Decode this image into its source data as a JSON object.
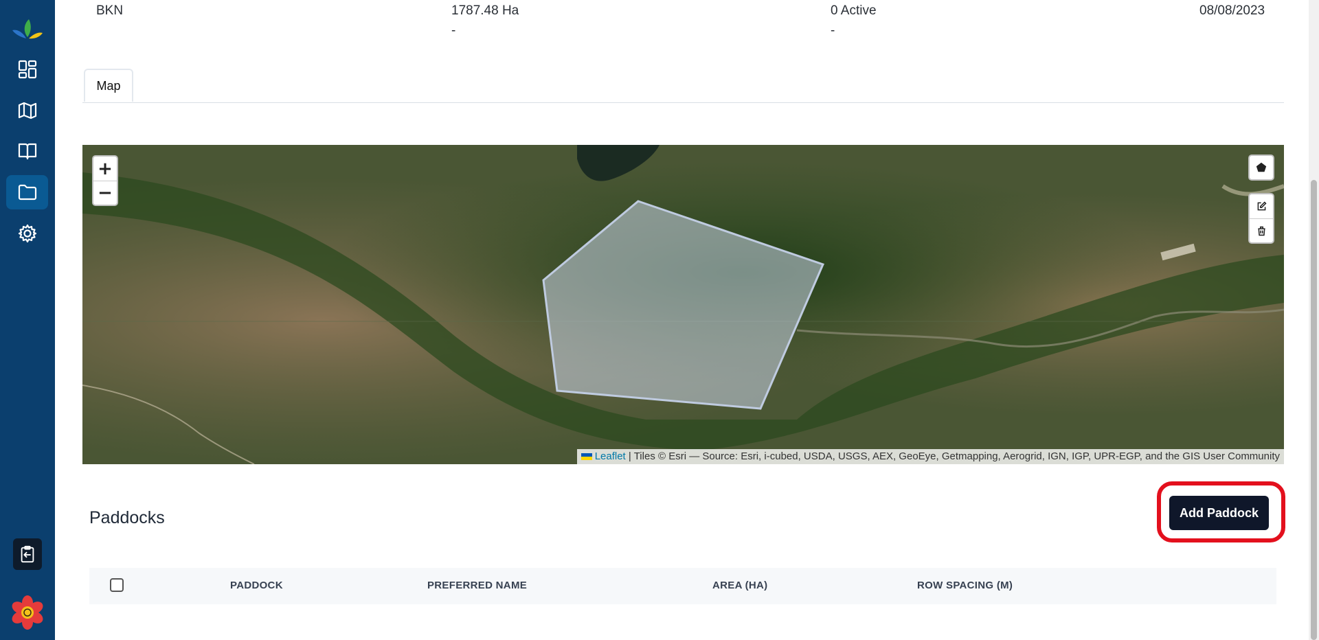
{
  "summary": {
    "col1": {
      "value": "BKN"
    },
    "col2": {
      "value": "1787.48 Ha",
      "sub": "-"
    },
    "col3": {
      "value": "0 Active",
      "sub": "-"
    },
    "col4": {
      "value": "08/08/2023"
    }
  },
  "tabs": [
    {
      "label": "Map"
    }
  ],
  "map": {
    "zoom_in_label": "+",
    "zoom_out_label": "−",
    "attribution": {
      "leaflet_label": "Leaflet",
      "text": "| Tiles © Esri — Source: Esri, i-cubed, USDA, USGS, AEX, GeoEye, Getmapping, Aerogrid, IGN, IGP, UPR-EGP, and the GIS User Community"
    }
  },
  "paddocks": {
    "title": "Paddocks",
    "add_button_label": "Add Paddock",
    "columns": [
      "PADDOCK",
      "PREFERRED NAME",
      "AREA (HA)",
      "ROW SPACING (M)"
    ]
  },
  "colors": {
    "sidebar": "#0b3f6e",
    "sidebar_active": "#0a5a93",
    "primary_button": "#0f172a",
    "highlight": "#e3101d"
  },
  "sidebar": {
    "items": [
      {
        "icon": "dashboard-icon"
      },
      {
        "icon": "map-icon"
      },
      {
        "icon": "book-icon"
      },
      {
        "icon": "folder-icon",
        "active": true
      },
      {
        "icon": "gear-icon"
      },
      {
        "icon": "clipboard-logout-icon"
      },
      {
        "icon": "flower-logo-icon"
      }
    ]
  }
}
